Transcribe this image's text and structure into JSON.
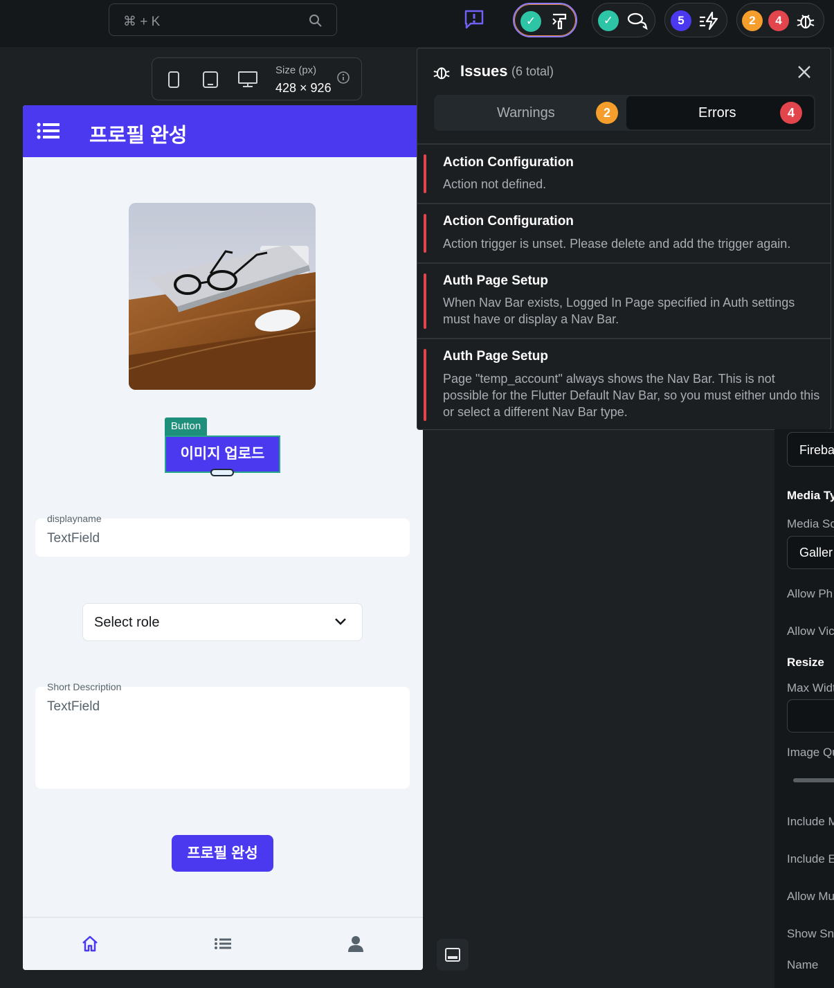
{
  "topbar": {
    "search_placeholder": "⌘ + K",
    "pills": [
      {
        "name": "theme-check"
      },
      {
        "name": "comments-check"
      },
      {
        "name": "actions",
        "count": "5"
      },
      {
        "name": "issues",
        "warnings": "2",
        "errors": "4"
      }
    ]
  },
  "device_bar": {
    "size_label": "Size (px)",
    "size_value": "428 × 926"
  },
  "phone": {
    "appbar_title": "프로필 완성",
    "button_tag": "Button",
    "upload_button": "이미지 업로드",
    "displayname": {
      "label": "displayname",
      "value": "TextField"
    },
    "role_dropdown": {
      "value": "Select role"
    },
    "short_description": {
      "label": "Short Description",
      "value": "TextField"
    },
    "submit_button": "프로필 완성",
    "nav_items": [
      "home-icon",
      "list-icon",
      "person-icon"
    ]
  },
  "issues": {
    "title": "Issues",
    "total": "(6 total)",
    "tabs": {
      "warnings_label": "Warnings",
      "warnings_count": "2",
      "errors_label": "Errors",
      "errors_count": "4"
    },
    "items": [
      {
        "title": "Action Configuration",
        "description": "Action not defined."
      },
      {
        "title": "Action Configuration",
        "description": "Action trigger is unset. Please delete and add the trigger again."
      },
      {
        "title": "Auth Page Setup",
        "description": "When Nav Bar exists, Logged In Page specified in Auth settings must have or display a Nav Bar."
      },
      {
        "title": "Auth Page Setup",
        "description": "Page \"temp_account\" always shows the Nav Bar. This is not possible for the Flutter Default Nav Bar, so you must either undo this or select a different Nav Bar type."
      }
    ]
  },
  "right_panel": {
    "source_value": "Firebas",
    "media_type_heading": "Media Ty",
    "media_source_label": "Media So",
    "media_source_value": "Galler",
    "allow_photo": "Allow Ph",
    "allow_video": "Allow Vic",
    "resize_heading": "Resize",
    "max_width": "Max Widt",
    "image_quality": "Image Qu",
    "include_m": "Include M",
    "include_e": "Include E",
    "allow_multiple": "Allow Mu",
    "show_snackbar": "Show Sna",
    "name_label": "Name"
  },
  "colors": {
    "primary": "#4b39ef",
    "teal": "#2ec4a6",
    "warning": "#f59e2b",
    "error": "#e2454b",
    "selection": "#25a58c"
  }
}
